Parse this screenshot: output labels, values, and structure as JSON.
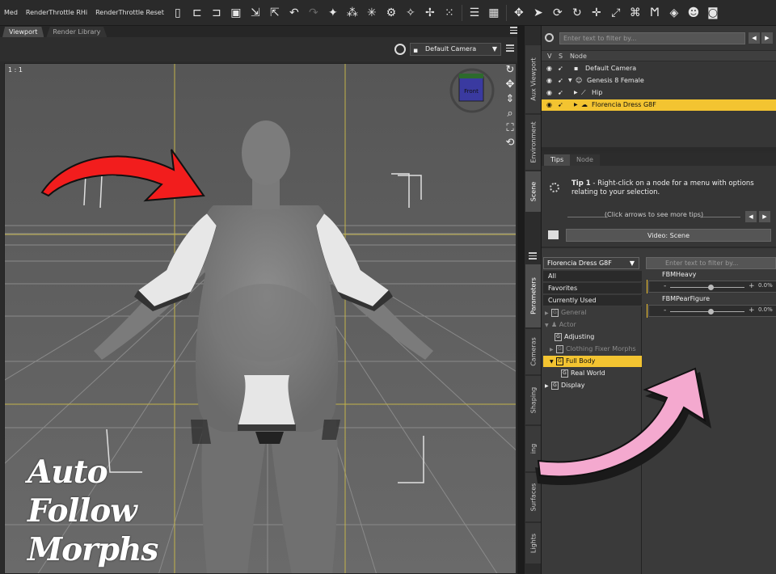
{
  "toolbar": {
    "items": [
      "Med",
      "RenderThrottle RHi",
      "RenderThrottle Reset"
    ]
  },
  "viewport": {
    "tabs": [
      "Viewport",
      "Render Library"
    ],
    "camera": "Default Camera",
    "label": "1 : 1",
    "cube_face": "Front"
  },
  "side_tabs": [
    "Aux Viewport",
    "Environment",
    "Scene",
    "Parameters",
    "Cameras",
    "Shaping",
    "ing",
    "Surfaces",
    "Lights"
  ],
  "scene": {
    "filter_placeholder": "Enter text to filter by...",
    "header": {
      "v": "V",
      "s": "S",
      "node": "Node"
    },
    "rows": [
      {
        "label": "Default Camera",
        "selected": false
      },
      {
        "label": "Genesis 8 Female",
        "selected": false
      },
      {
        "label": "Hip",
        "selected": false
      },
      {
        "label": "Florencia Dress G8F",
        "selected": true
      }
    ]
  },
  "tips": {
    "tabs": [
      "Tips",
      "Node"
    ],
    "title": "Tip 1",
    "text": " - Right-click on a node for a menu with options relating to your selection.",
    "hint": "(Click arrows to see more tips)",
    "video_button": "Video: Scene"
  },
  "params": {
    "node_select": "Florencia Dress G8F",
    "filter_placeholder": "Enter text to filter by...",
    "tree": [
      {
        "label": "All",
        "type": "head"
      },
      {
        "label": "Favorites",
        "type": "head"
      },
      {
        "label": "Currently Used",
        "type": "head"
      },
      {
        "label": "General",
        "type": "dim"
      },
      {
        "label": "Actor",
        "type": "dim"
      },
      {
        "label": "Adjusting",
        "type": "normal"
      },
      {
        "label": "Clothing Fixer Morphs",
        "type": "dim"
      },
      {
        "label": "Full Body",
        "type": "selected"
      },
      {
        "label": "Real World",
        "type": "normal"
      },
      {
        "label": "Display",
        "type": "normal"
      }
    ],
    "sliders": [
      {
        "name": "FBMHeavy",
        "value": "0.0%",
        "level": 0.5
      },
      {
        "name": "FBMPearFigure",
        "value": "0.0%",
        "level": 0.5
      }
    ]
  },
  "caption": {
    "line1": "Auto Follow",
    "line2": "Morphs"
  },
  "colors": {
    "accent": "#f3c431",
    "red_arrow": "#f21d1d",
    "pink_arrow": "#f4a9cf"
  }
}
